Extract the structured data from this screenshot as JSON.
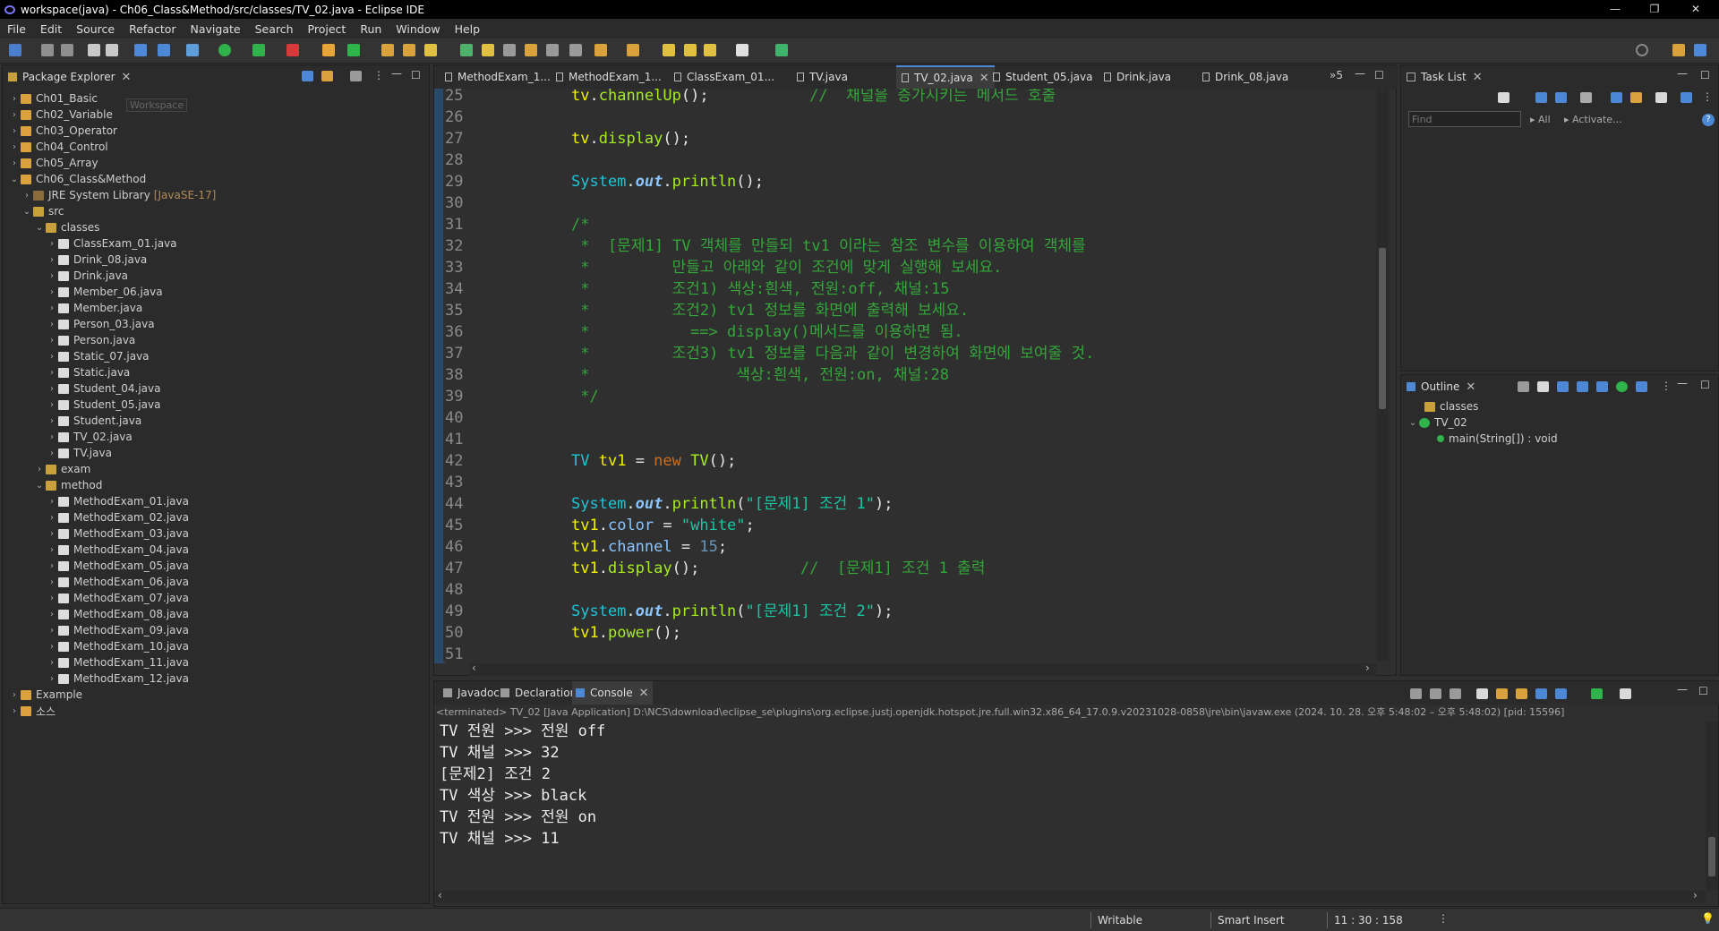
{
  "window": {
    "title": "workspace(java) - Ch06_Class&Method/src/classes/TV_02.java - Eclipse IDE",
    "minimize": "—",
    "restore": "❐",
    "close": "✕"
  },
  "menu": [
    "File",
    "Edit",
    "Source",
    "Refactor",
    "Navigate",
    "Search",
    "Project",
    "Run",
    "Window",
    "Help"
  ],
  "package_explorer": {
    "tab_label": "Package Explorer",
    "tooltip": "Workspace",
    "items": [
      {
        "label": "Ch01_Basic",
        "depth": 0,
        "arrow": "›",
        "icon": "project"
      },
      {
        "label": "Ch02_Variable",
        "depth": 0,
        "arrow": "›",
        "icon": "project"
      },
      {
        "label": "Ch03_Operator",
        "depth": 0,
        "arrow": "›",
        "icon": "project"
      },
      {
        "label": "Ch04_Control",
        "depth": 0,
        "arrow": "›",
        "icon": "project"
      },
      {
        "label": "Ch05_Array",
        "depth": 0,
        "arrow": "›",
        "icon": "project"
      },
      {
        "label": "Ch06_Class&Method",
        "depth": 0,
        "arrow": "⌄",
        "icon": "project"
      },
      {
        "label": "JRE System Library",
        "extra": "[JavaSE-17]",
        "depth": 1,
        "arrow": "›",
        "icon": "library"
      },
      {
        "label": "src",
        "depth": 1,
        "arrow": "⌄",
        "icon": "src"
      },
      {
        "label": "classes",
        "depth": 2,
        "arrow": "⌄",
        "icon": "package"
      },
      {
        "label": "ClassExam_01.java",
        "depth": 3,
        "arrow": "›",
        "icon": "java"
      },
      {
        "label": "Drink_08.java",
        "depth": 3,
        "arrow": "›",
        "icon": "java"
      },
      {
        "label": "Drink.java",
        "depth": 3,
        "arrow": "›",
        "icon": "java"
      },
      {
        "label": "Member_06.java",
        "depth": 3,
        "arrow": "›",
        "icon": "java"
      },
      {
        "label": "Member.java",
        "depth": 3,
        "arrow": "›",
        "icon": "java"
      },
      {
        "label": "Person_03.java",
        "depth": 3,
        "arrow": "›",
        "icon": "java"
      },
      {
        "label": "Person.java",
        "depth": 3,
        "arrow": "›",
        "icon": "java"
      },
      {
        "label": "Static_07.java",
        "depth": 3,
        "arrow": "›",
        "icon": "java"
      },
      {
        "label": "Static.java",
        "depth": 3,
        "arrow": "›",
        "icon": "java"
      },
      {
        "label": "Student_04.java",
        "depth": 3,
        "arrow": "›",
        "icon": "java"
      },
      {
        "label": "Student_05.java",
        "depth": 3,
        "arrow": "›",
        "icon": "java"
      },
      {
        "label": "Student.java",
        "depth": 3,
        "arrow": "›",
        "icon": "java"
      },
      {
        "label": "TV_02.java",
        "depth": 3,
        "arrow": "›",
        "icon": "java"
      },
      {
        "label": "TV.java",
        "depth": 3,
        "arrow": "›",
        "icon": "java"
      },
      {
        "label": "exam",
        "depth": 2,
        "arrow": "›",
        "icon": "package"
      },
      {
        "label": "method",
        "depth": 2,
        "arrow": "⌄",
        "icon": "package"
      },
      {
        "label": "MethodExam_01.java",
        "depth": 3,
        "arrow": "›",
        "icon": "java"
      },
      {
        "label": "MethodExam_02.java",
        "depth": 3,
        "arrow": "›",
        "icon": "java"
      },
      {
        "label": "MethodExam_03.java",
        "depth": 3,
        "arrow": "›",
        "icon": "java"
      },
      {
        "label": "MethodExam_04.java",
        "depth": 3,
        "arrow": "›",
        "icon": "java"
      },
      {
        "label": "MethodExam_05.java",
        "depth": 3,
        "arrow": "›",
        "icon": "java"
      },
      {
        "label": "MethodExam_06.java",
        "depth": 3,
        "arrow": "›",
        "icon": "java"
      },
      {
        "label": "MethodExam_07.java",
        "depth": 3,
        "arrow": "›",
        "icon": "java"
      },
      {
        "label": "MethodExam_08.java",
        "depth": 3,
        "arrow": "›",
        "icon": "java"
      },
      {
        "label": "MethodExam_09.java",
        "depth": 3,
        "arrow": "›",
        "icon": "java"
      },
      {
        "label": "MethodExam_10.java",
        "depth": 3,
        "arrow": "›",
        "icon": "java"
      },
      {
        "label": "MethodExam_11.java",
        "depth": 3,
        "arrow": "›",
        "icon": "java"
      },
      {
        "label": "MethodExam_12.java",
        "depth": 3,
        "arrow": "›",
        "icon": "java"
      },
      {
        "label": "Example",
        "depth": 0,
        "arrow": "›",
        "icon": "project"
      },
      {
        "label": "소스",
        "depth": 0,
        "arrow": "›",
        "icon": "project"
      }
    ]
  },
  "editor": {
    "tabs": [
      "MethodExam_1...",
      "MethodExam_1...",
      "ClassExam_01...",
      "TV.java",
      "TV_02.java",
      "Student_05.java",
      "Drink.java",
      "Drink_08.java"
    ],
    "active_tab": 4,
    "overflow": "»5",
    "lines": [
      {
        "n": "25",
        "toks": [
          [
            "var",
            "tv"
          ],
          [
            "plain",
            "."
          ],
          [
            "mth",
            "channelUp"
          ],
          [
            "plain",
            "();           "
          ],
          [
            "cm",
            "//  채널을 증가시키는 메서드 호출"
          ]
        ]
      },
      {
        "n": "26",
        "toks": []
      },
      {
        "n": "27",
        "toks": [
          [
            "var",
            "tv"
          ],
          [
            "plain",
            "."
          ],
          [
            "mth",
            "display"
          ],
          [
            "plain",
            "();"
          ]
        ]
      },
      {
        "n": "28",
        "toks": []
      },
      {
        "n": "29",
        "toks": [
          [
            "cls",
            "System"
          ],
          [
            "plain",
            "."
          ],
          [
            "sfld",
            "out"
          ],
          [
            "plain",
            "."
          ],
          [
            "mth",
            "println"
          ],
          [
            "plain",
            "();"
          ]
        ]
      },
      {
        "n": "30",
        "toks": []
      },
      {
        "n": "31",
        "toks": [
          [
            "cm",
            "/*"
          ]
        ]
      },
      {
        "n": "32",
        "toks": [
          [
            "cm",
            " *  [문제1] TV 객체를 만들되 tv1 이라는 참조 변수를 이용하여 객체를"
          ]
        ]
      },
      {
        "n": "33",
        "toks": [
          [
            "cm",
            " *         만들고 아래와 같이 조건에 맞게 실행해 보세요."
          ]
        ]
      },
      {
        "n": "34",
        "toks": [
          [
            "cm",
            " *         조건1) 색상:흰색, 전원:off, 채널:15"
          ]
        ]
      },
      {
        "n": "35",
        "toks": [
          [
            "cm",
            " *         조건2) tv1 정보를 화면에 출력해 보세요."
          ]
        ]
      },
      {
        "n": "36",
        "toks": [
          [
            "cm",
            " *           ==> display()메서드를 이용하면 됨."
          ]
        ]
      },
      {
        "n": "37",
        "toks": [
          [
            "cm",
            " *         조건3) tv1 정보를 다음과 같이 변경하여 화면에 보여줄 것."
          ]
        ]
      },
      {
        "n": "38",
        "toks": [
          [
            "cm",
            " *                색상:흰색, 전원:on, 채널:28"
          ]
        ]
      },
      {
        "n": "39",
        "toks": [
          [
            "cm",
            " */"
          ]
        ]
      },
      {
        "n": "40",
        "toks": []
      },
      {
        "n": "41",
        "toks": []
      },
      {
        "n": "42",
        "toks": [
          [
            "cls",
            "TV"
          ],
          [
            "plain",
            " "
          ],
          [
            "var",
            "tv1"
          ],
          [
            "plain",
            " = "
          ],
          [
            "kw",
            "new"
          ],
          [
            "plain",
            " "
          ],
          [
            "mth",
            "TV"
          ],
          [
            "plain",
            "();"
          ]
        ]
      },
      {
        "n": "43",
        "toks": []
      },
      {
        "n": "44",
        "toks": [
          [
            "cls",
            "System"
          ],
          [
            "plain",
            "."
          ],
          [
            "sfld",
            "out"
          ],
          [
            "plain",
            "."
          ],
          [
            "mth",
            "println"
          ],
          [
            "plain",
            "("
          ],
          [
            "str",
            "\"[문제1] 조건 1\""
          ],
          [
            "plain",
            ");"
          ]
        ]
      },
      {
        "n": "45",
        "toks": [
          [
            "var",
            "tv1"
          ],
          [
            "plain",
            "."
          ],
          [
            "fld",
            "color"
          ],
          [
            "plain",
            " = "
          ],
          [
            "str",
            "\"white\""
          ],
          [
            "plain",
            ";"
          ]
        ]
      },
      {
        "n": "46",
        "toks": [
          [
            "var",
            "tv1"
          ],
          [
            "plain",
            "."
          ],
          [
            "fld",
            "channel"
          ],
          [
            "plain",
            " = "
          ],
          [
            "num",
            "15"
          ],
          [
            "plain",
            ";"
          ]
        ]
      },
      {
        "n": "47",
        "toks": [
          [
            "var",
            "tv1"
          ],
          [
            "plain",
            "."
          ],
          [
            "mth",
            "display"
          ],
          [
            "plain",
            "();           "
          ],
          [
            "cm",
            "//  [문제1] 조건 1 출력"
          ]
        ]
      },
      {
        "n": "48",
        "toks": []
      },
      {
        "n": "49",
        "toks": [
          [
            "cls",
            "System"
          ],
          [
            "plain",
            "."
          ],
          [
            "sfld",
            "out"
          ],
          [
            "plain",
            "."
          ],
          [
            "mth",
            "println"
          ],
          [
            "plain",
            "("
          ],
          [
            "str",
            "\"[문제1] 조건 2\""
          ],
          [
            "plain",
            ");"
          ]
        ]
      },
      {
        "n": "50",
        "toks": [
          [
            "var",
            "tv1"
          ],
          [
            "plain",
            "."
          ],
          [
            "mth",
            "power"
          ],
          [
            "plain",
            "();"
          ]
        ]
      },
      {
        "n": "51",
        "toks": []
      }
    ]
  },
  "task_list": {
    "tab_label": "Task List",
    "find_placeholder": "Find",
    "all_label": "All",
    "activate_label": "Activate..."
  },
  "outline": {
    "tab_label": "Outline",
    "items": [
      {
        "label": "classes",
        "depth": 0
      },
      {
        "label": "TV_02",
        "depth": 0
      },
      {
        "label": "main(String[]) : void",
        "depth": 1
      }
    ]
  },
  "console_panel": {
    "tabs": [
      "Javadoc",
      "Declaration",
      "Console"
    ],
    "active_tab": 2,
    "header": "<terminated> TV_02 [Java Application] D:\\NCS\\download\\eclipse_se\\plugins\\org.eclipse.justj.openjdk.hotspot.jre.full.win32.x86_64_17.0.9.v20231028-0858\\jre\\bin\\javaw.exe  (2024. 10. 28. 오후 5:48:02 – 오후 5:48:02) [pid: 15596]",
    "lines": [
      "TV 전원 >>> 전원 off",
      "TV 채널 >>> 32",
      "[문제2] 조건 2",
      "TV 색상 >>> black",
      "TV 전원 >>> 전원 on",
      "TV 채널 >>> 11"
    ]
  },
  "status_bar": {
    "writable": "Writable",
    "insert_mode": "Smart Insert",
    "position": "11 : 30 : 158"
  },
  "colors": {
    "comment": "#34a63a",
    "keyword": "#cc6c1d",
    "string": "#17c6a3",
    "class": "#1ec5d6",
    "variable": "#f2f200",
    "method": "#a7ec21"
  }
}
